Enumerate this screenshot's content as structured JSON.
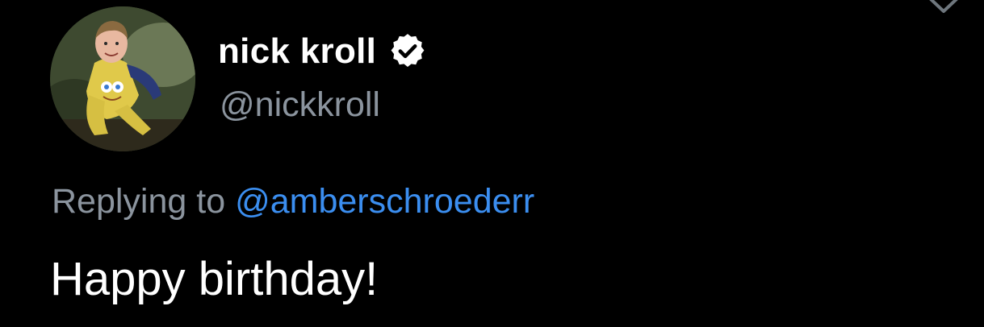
{
  "tweet": {
    "author": {
      "display_name": "nick kroll",
      "handle": "@nickkroll",
      "verified": true,
      "avatar_icon": "avatar-photo"
    },
    "reply": {
      "prefix": "Replying to",
      "to_handle": "@amberschroederr"
    },
    "text": "Happy birthday!",
    "menu_icon": "chevron-down-icon"
  },
  "colors": {
    "background": "#000000",
    "primary_text": "#ffffff",
    "secondary_text": "#8b949e",
    "link": "#3b8ef0"
  }
}
